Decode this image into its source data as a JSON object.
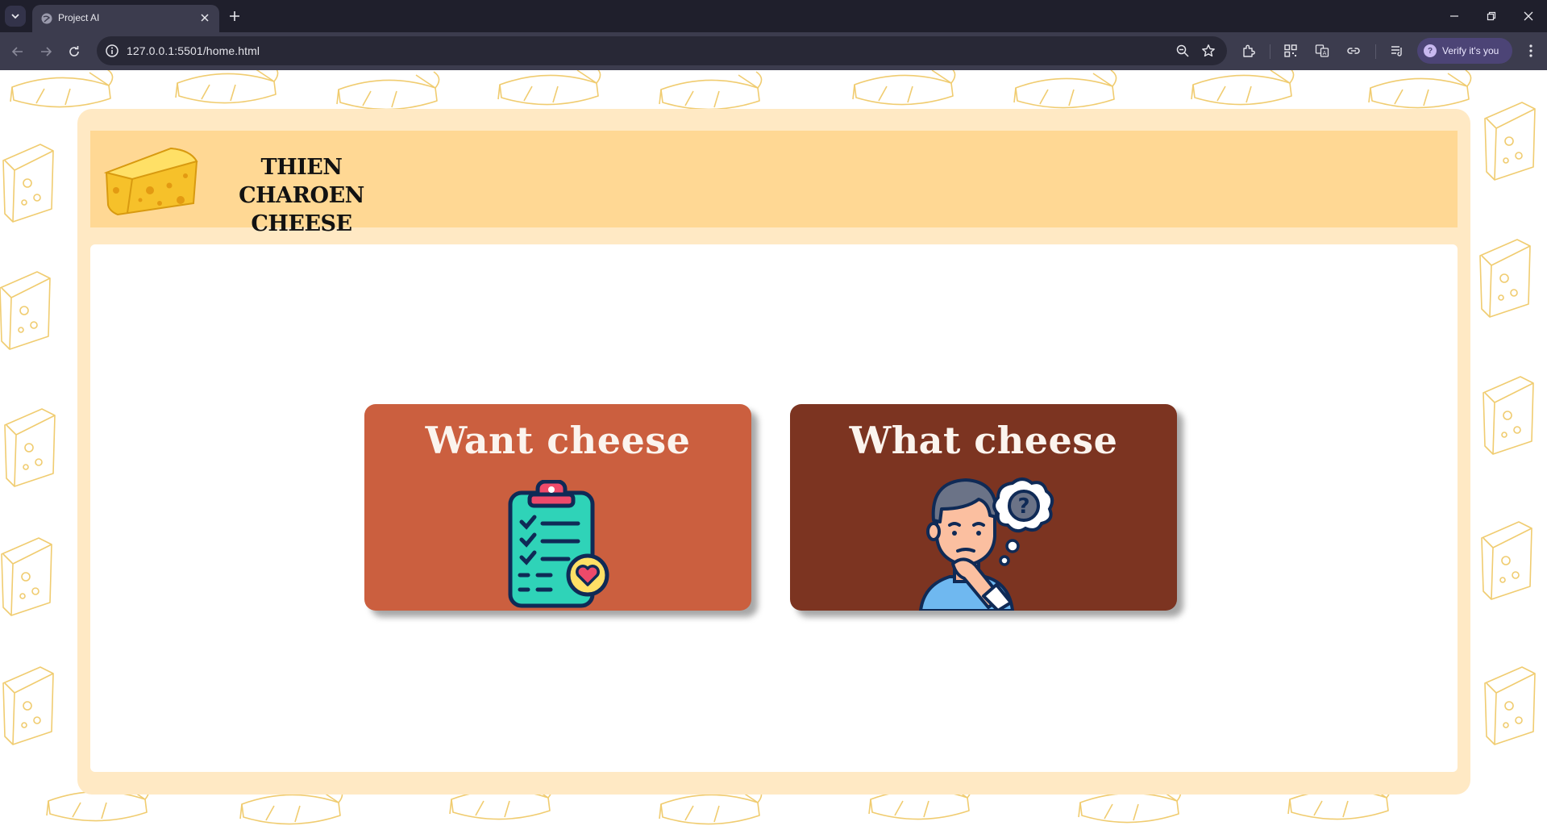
{
  "browser": {
    "tab_title": "Project AI",
    "url": "127.0.0.1:5501/home.html",
    "verify_label": "Verify it's you"
  },
  "site": {
    "brand_line1": "THIEN CHAROEN",
    "brand_line2": "CHEESE"
  },
  "cards": [
    {
      "title": "Want cheese",
      "icon": "clipboard-heart-icon",
      "color": "#cb5f3f"
    },
    {
      "title": "What cheese",
      "icon": "thinking-person-icon",
      "color": "#7c3421"
    }
  ],
  "colors": {
    "frame": "#ffe9c4",
    "header": "#ffd894",
    "pattern_stroke": "#f0cc70"
  }
}
